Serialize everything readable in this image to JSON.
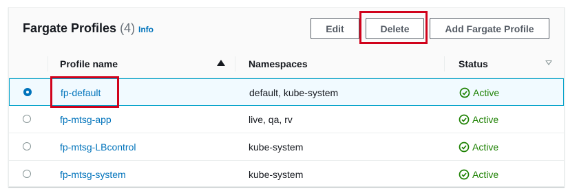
{
  "header": {
    "title": "Fargate Profiles",
    "count": "(4)",
    "info": "Info",
    "buttons": {
      "edit": "Edit",
      "delete": "Delete",
      "add": "Add Fargate Profile"
    }
  },
  "table": {
    "columns": {
      "name": "Profile name",
      "namespaces": "Namespaces",
      "status": "Status"
    },
    "sort": "ascending",
    "rows": [
      {
        "name": "fp-default",
        "namespaces": "default, kube-system",
        "status": "Active",
        "selected": true
      },
      {
        "name": "fp-mtsg-app",
        "namespaces": "live, qa, rv",
        "status": "Active",
        "selected": false
      },
      {
        "name": "fp-mtsg-LBcontrol",
        "namespaces": "kube-system",
        "status": "Active",
        "selected": false
      },
      {
        "name": "fp-mtsg-system",
        "namespaces": "kube-system",
        "status": "Active",
        "selected": false
      }
    ]
  },
  "colors": {
    "link": "#0073bb",
    "success": "#1d8102",
    "highlight": "#d0021b"
  },
  "icons": {
    "status": "check-circle-icon",
    "sort": "sort-ascending-icon",
    "filter": "filter-down-icon"
  }
}
